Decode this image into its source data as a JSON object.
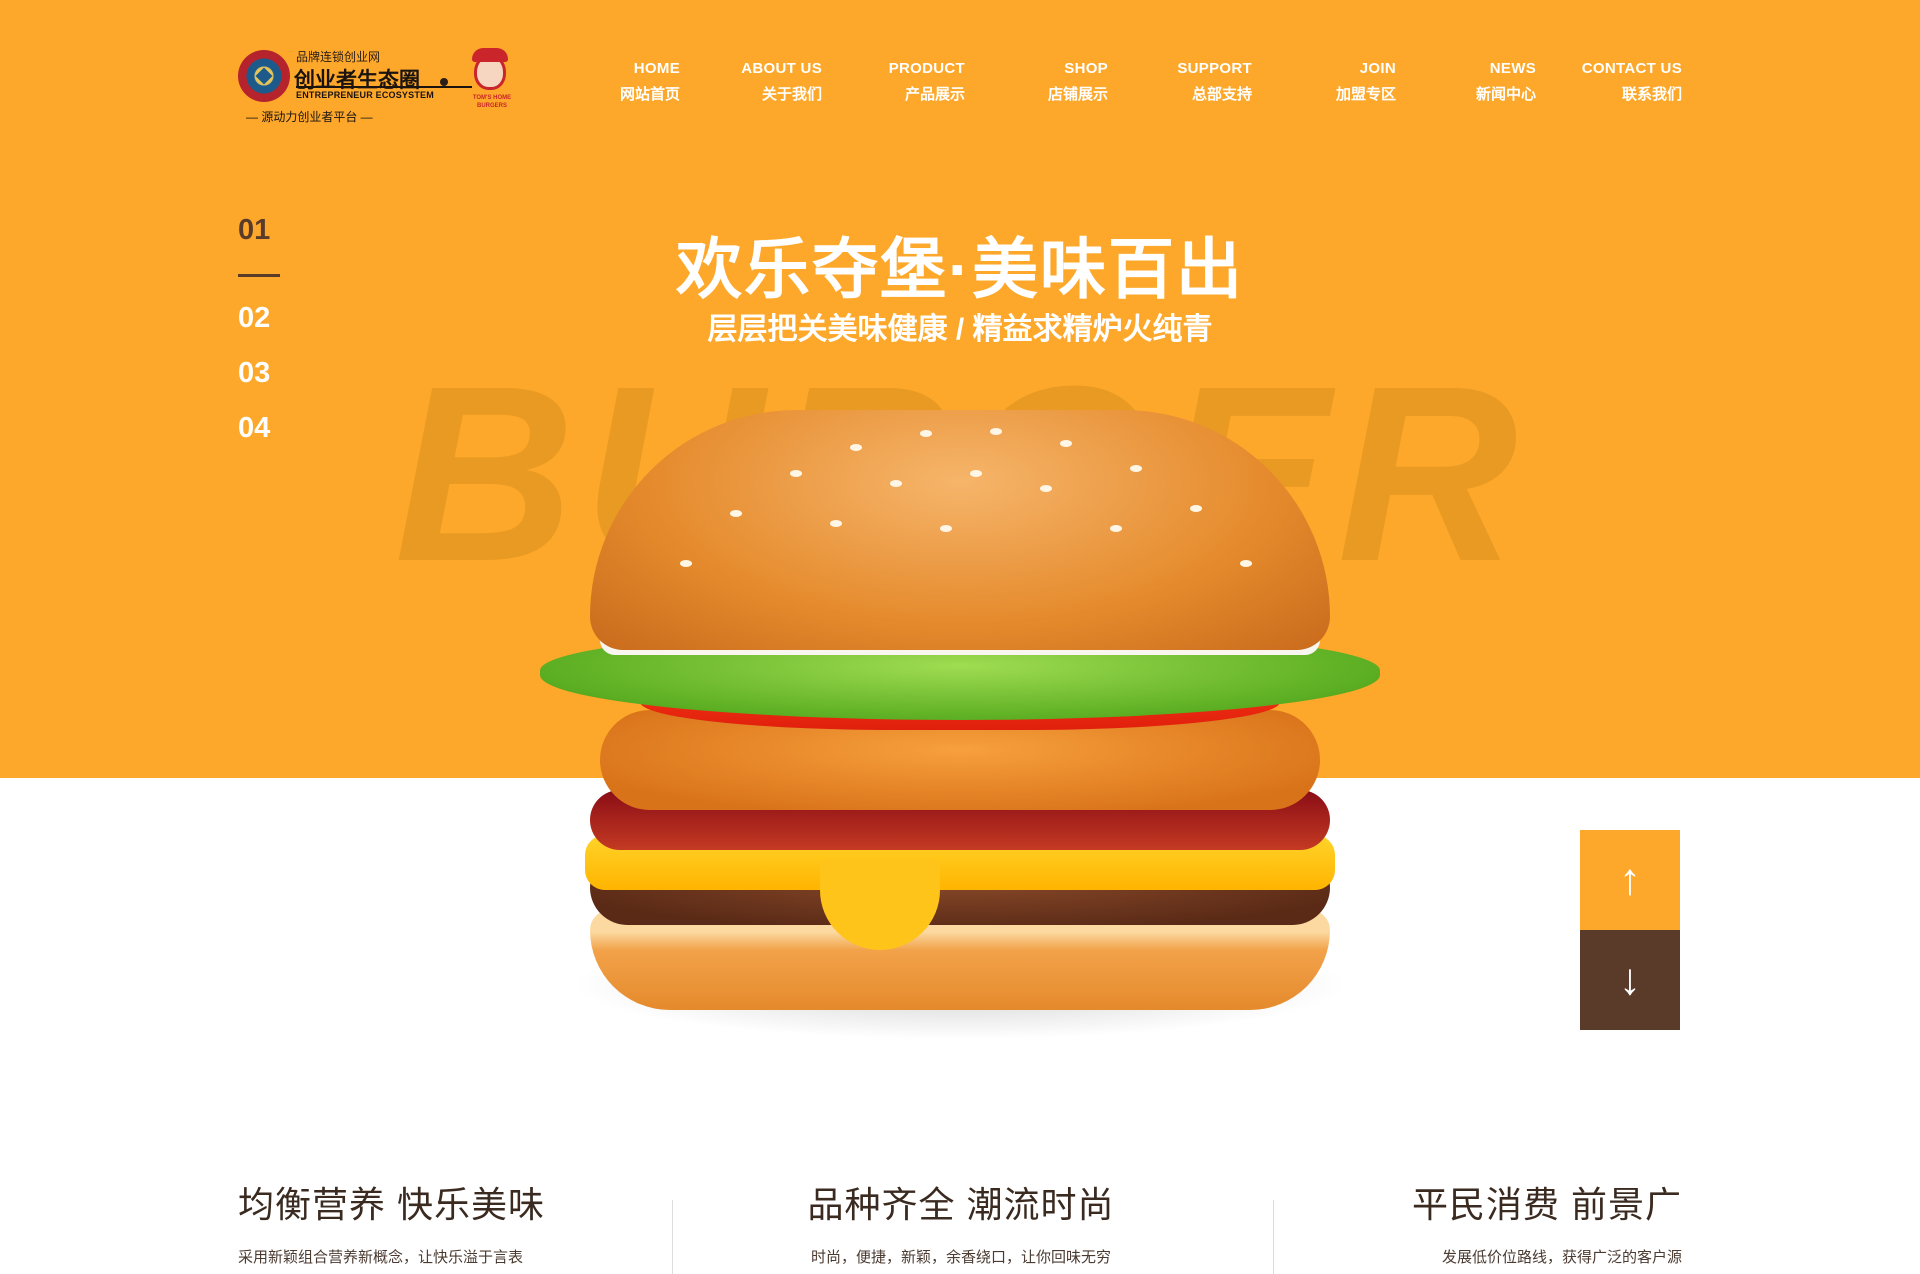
{
  "colors": {
    "accent": "#fda82a",
    "dark_brown": "#5a3b2a",
    "white": "#ffffff"
  },
  "logo": {
    "site_small": "品牌连锁创业网",
    "site_big": "创业者生态圈",
    "site_en": "ENTREPRENEUR ECOSYSTEM",
    "slogan": "— 源动力创业者平台 —",
    "brand_text": "TOM'S HOME BURGERS"
  },
  "nav": [
    {
      "en": "HOME",
      "cn": "网站首页"
    },
    {
      "en": "ABOUT US",
      "cn": "关于我们"
    },
    {
      "en": "PRODUCT",
      "cn": "产品展示"
    },
    {
      "en": "SHOP",
      "cn": "店铺展示"
    },
    {
      "en": "SUPPORT",
      "cn": "总部支持"
    },
    {
      "en": "JOIN",
      "cn": "加盟专区"
    },
    {
      "en": "NEWS",
      "cn": "新闻中心"
    },
    {
      "en": "CONTACT US",
      "cn": "联系我们"
    }
  ],
  "slides": [
    "01",
    "02",
    "03",
    "04"
  ],
  "hero": {
    "title": "欢乐夺堡·美味百出",
    "subtitle": "层层把关美味健康 / 精益求精炉火纯青",
    "watermark": "BURGER"
  },
  "arrows": {
    "up": "↑",
    "down": "↓"
  },
  "features": [
    {
      "title": "均衡营养 快乐美味",
      "desc": "采用新颖组合营养新概念，让快乐溢于言表"
    },
    {
      "title": "品种齐全 潮流时尚",
      "desc": "时尚，便捷，新颖，余香绕口，让你回味无穷"
    },
    {
      "title": "平民消费 前景广",
      "desc": "发展低价位路线，获得广泛的客户源"
    }
  ]
}
